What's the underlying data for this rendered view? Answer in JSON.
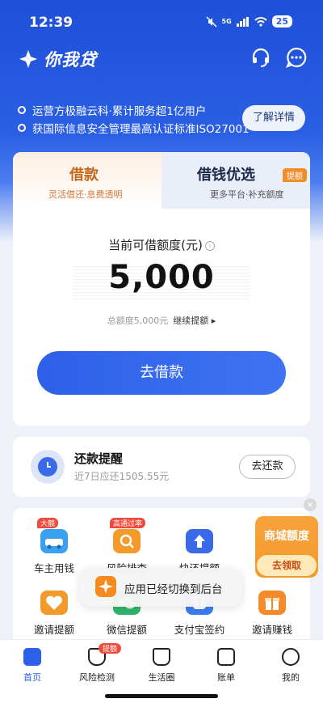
{
  "status_bar": {
    "time": "12:39",
    "network": "5G",
    "battery": "25"
  },
  "header": {
    "app_name": "你我贷",
    "notices": [
      "运营方极融云科·累计服务超1亿用户",
      "获国际信息安全管理最高认证标准ISO27001"
    ],
    "detail_button": "了解详情"
  },
  "loan_card": {
    "tab_borrow": {
      "title": "借款",
      "subtitle": "灵活借还·息费透明"
    },
    "tab_other": {
      "title": "借钱优选",
      "tag": "提额",
      "subtitle": "更多平台·补充额度"
    },
    "limit_label": "当前可借额度(元)",
    "limit_amount": "5,000",
    "total_label": "总额度5,000元",
    "raise_link": "继续提额 ▸",
    "borrow_button": "去借款"
  },
  "repay": {
    "title": "还款提醒",
    "subtitle": "近7日应还1505.55元",
    "button": "去还款"
  },
  "services": [
    {
      "label": "车主用钱",
      "tag": "大额",
      "color": "#3aa0f0"
    },
    {
      "label": "风险排查",
      "tag": "高通过率",
      "color": "#f59a2a"
    },
    {
      "label": "快还提额",
      "tag": "",
      "color": "#3b6ae8"
    },
    {
      "label": "邀请提额",
      "tag": "",
      "color": "#f29b2a"
    },
    {
      "label": "微信提额",
      "tag": "",
      "color": "#2fb56b"
    },
    {
      "label": "支付宝签约",
      "tag": "",
      "color": "#3b7ef0"
    },
    {
      "label": "邀请赚钱",
      "tag": "",
      "color": "#f48a2a"
    }
  ],
  "promo": {
    "title": "商城额度",
    "button": "去领取",
    "close": "×"
  },
  "toast": {
    "text": "应用已经切换到后台"
  },
  "bottom_nav": [
    {
      "label": "首页",
      "tag": ""
    },
    {
      "label": "风险检测",
      "tag": "提额"
    },
    {
      "label": "生活圈",
      "tag": ""
    },
    {
      "label": "账单",
      "tag": ""
    },
    {
      "label": "我的",
      "tag": ""
    }
  ]
}
